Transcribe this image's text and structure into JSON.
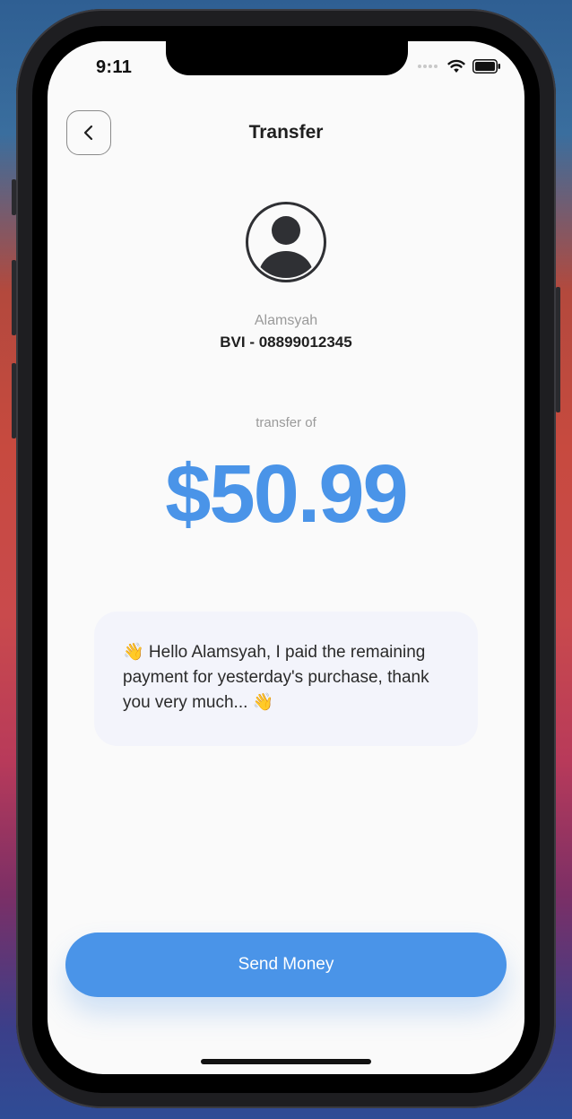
{
  "status_bar": {
    "time": "9:11",
    "icons": [
      "cellular-signal-icon",
      "wifi-icon",
      "battery-icon"
    ]
  },
  "header": {
    "back_icon": "chevron-left-icon",
    "title": "Transfer"
  },
  "recipient": {
    "avatar_icon": "user-avatar-icon",
    "name": "Alamsyah",
    "account": "BVI - 08899012345"
  },
  "transfer": {
    "label": "transfer of",
    "amount": "$50.99"
  },
  "message": {
    "text": "👋 Hello Alamsyah, I paid the remaining payment for yesterday's purchase, thank you very much... 👋"
  },
  "actions": {
    "send_label": "Send Money"
  },
  "colors": {
    "accent": "#4a94e8",
    "background": "#fafafa",
    "message_card": "#f3f4fb",
    "text_primary": "#1f1f1f",
    "text_secondary": "#9a9a9a"
  }
}
